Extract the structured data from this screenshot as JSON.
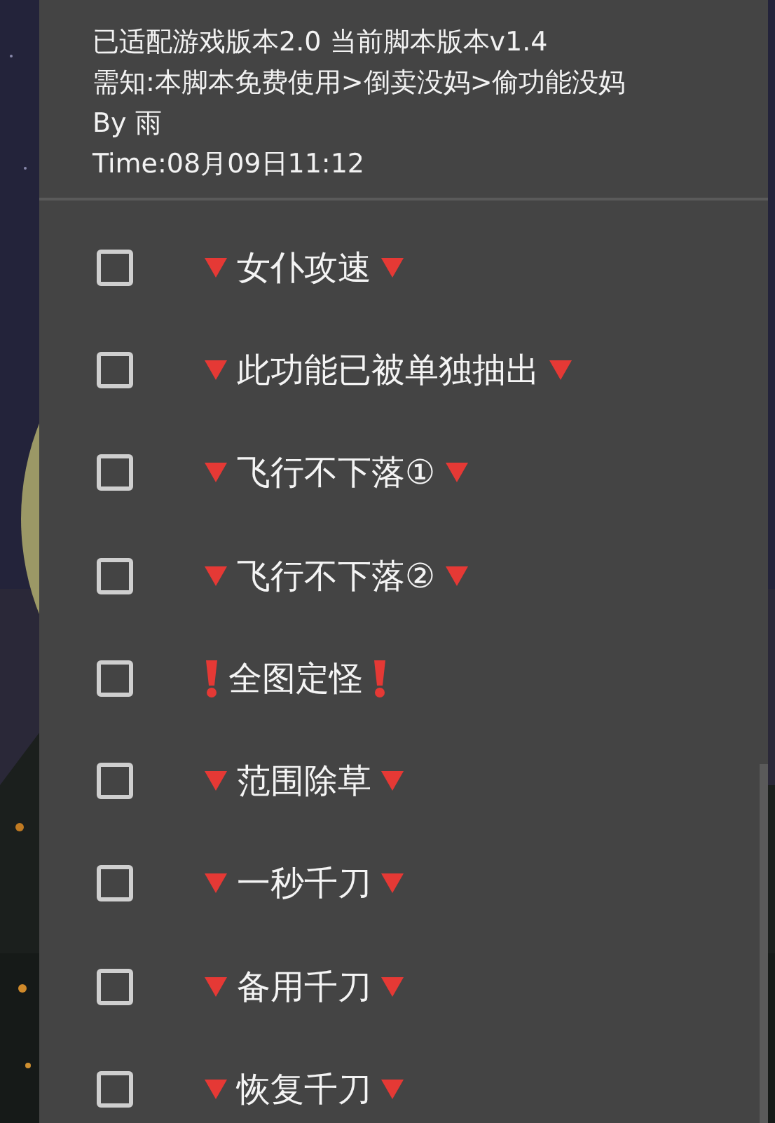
{
  "header": {
    "lines": [
      "已适配游戏版本2.0  当前脚本版本v1.4",
      "需知:本脚本免费使用>倒卖没妈>偷功能没妈",
      "By 雨",
      "Time:08月09日11:12"
    ]
  },
  "options": [
    {
      "label": "女仆攻速",
      "kind": "triangle",
      "checked": false
    },
    {
      "label": "此功能已被单独抽出",
      "kind": "triangle",
      "checked": false
    },
    {
      "label": "飞行不下落①",
      "kind": "triangle",
      "checked": false
    },
    {
      "label": "飞行不下落②",
      "kind": "triangle",
      "checked": false
    },
    {
      "label": "全图定怪",
      "kind": "exclamation",
      "checked": false
    },
    {
      "label": "范围除草",
      "kind": "triangle",
      "checked": false
    },
    {
      "label": "一秒千刀",
      "kind": "triangle",
      "checked": false
    },
    {
      "label": "备用千刀",
      "kind": "triangle",
      "checked": false
    },
    {
      "label": "恢复千刀",
      "kind": "triangle",
      "checked": false
    }
  ]
}
